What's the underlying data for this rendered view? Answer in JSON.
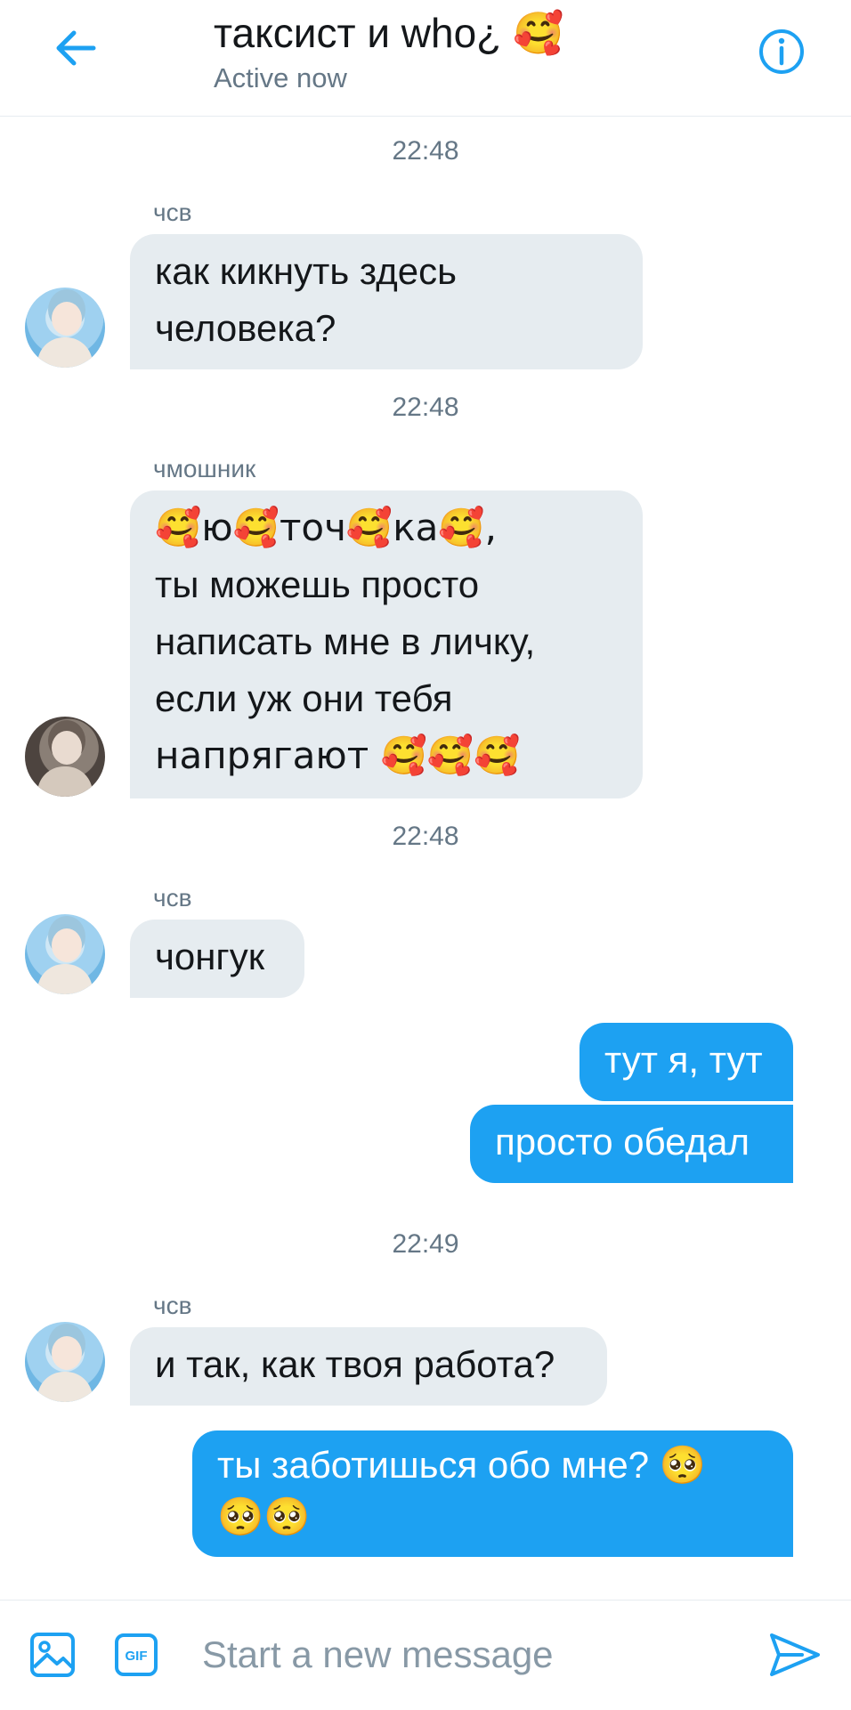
{
  "header": {
    "title": "таксист и who¿ 🥰",
    "status": "Active now"
  },
  "messages": [
    {
      "timestamp": "22:48",
      "sender": "чсв",
      "lines": [
        "как кикнуть здесь",
        "человека?"
      ]
    },
    {
      "timestamp": "22:48",
      "sender": "чмошник",
      "lines": [
        "🥰ю🥰точ🥰ка🥰,",
        "ты можешь просто",
        "написать мне в личку,",
        "если уж они тебя",
        "напрягают 🥰🥰🥰"
      ]
    },
    {
      "timestamp": "22:48",
      "sender": "чсв",
      "lines": [
        "чонгук"
      ]
    },
    {
      "outgoing": true,
      "lines": [
        "тут я, тут"
      ]
    },
    {
      "outgoing": true,
      "lines": [
        "просто обедал"
      ]
    },
    {
      "timestamp": "22:49",
      "sender": "чсв",
      "lines": [
        "и так, как твоя работа?"
      ]
    },
    {
      "outgoing": true,
      "lines": [
        "ты заботишься обо мне? 🥺",
        "🥺🥺"
      ]
    }
  ],
  "composer": {
    "placeholder": "Start a new message",
    "gif_label": "GIF"
  },
  "colors": {
    "accent": "#1da1f2",
    "incoming_bubble": "#e6ecf0",
    "secondary_text": "#657786"
  }
}
